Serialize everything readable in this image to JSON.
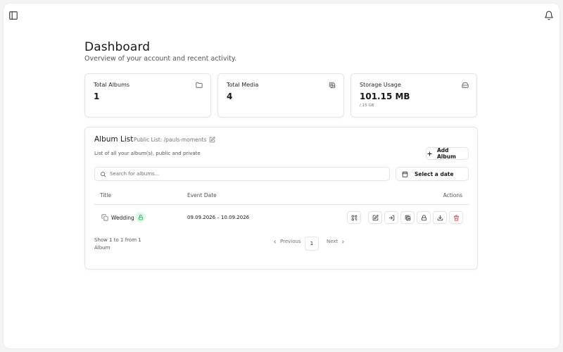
{
  "header": {
    "sidebar_toggle_icon": "sidebar-panel-icon",
    "notifications_icon": "bell-icon"
  },
  "page": {
    "title": "Dashboard",
    "subtitle": "Overview of your account and recent activity."
  },
  "stats": [
    {
      "label": "Total Albums",
      "value": "1",
      "icon": "folder-icon"
    },
    {
      "label": "Total Media",
      "value": "4",
      "icon": "images-icon"
    },
    {
      "label": "Storage Usage",
      "value": "101.15 MB",
      "subvalue": "/ 15 GB",
      "icon": "hard-drive-icon"
    }
  ],
  "album_list": {
    "title": "Album List",
    "public_list": "Public List: /pauls-moments",
    "description": "List of all your album(s), public and private",
    "add_button": "Add Album",
    "search_placeholder": "Search for albums...",
    "date_button": "Select a date",
    "columns": {
      "title": "Title",
      "event_date": "Event Date",
      "actions": "Actions"
    },
    "rows": [
      {
        "title": "Wedding",
        "event_date": "09.09.2026 – 10.09.2026",
        "visibility": "public"
      }
    ],
    "row_actions": [
      "qr-code-icon",
      "edit-icon",
      "share-icon",
      "images-icon",
      "lock-icon",
      "download-icon",
      "trash-icon"
    ],
    "showing": "Show 1 to 1 from 1 Album",
    "pagination": {
      "previous": "Previous",
      "current_page": "1",
      "next": "Next"
    }
  },
  "colors": {
    "accent_green_bg": "#dcfce7",
    "accent_green": "#16a34a",
    "danger": "#dc2626",
    "border": "#e4e4e7"
  }
}
